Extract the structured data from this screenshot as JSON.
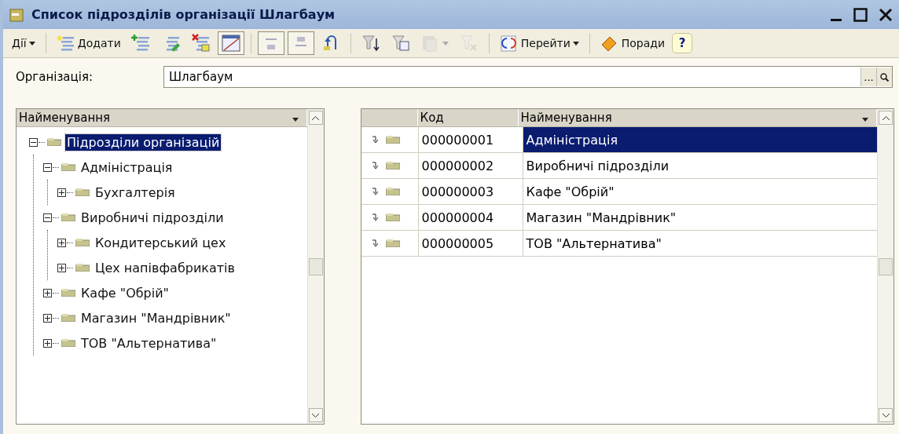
{
  "window": {
    "title": "Список підрозділів організації Шлагбаум"
  },
  "toolbar": [
    {
      "kind": "menu",
      "label": "Дії"
    },
    {
      "kind": "separator"
    },
    {
      "kind": "button",
      "label": "Додати"
    },
    {
      "kind": "button"
    },
    {
      "kind": "button"
    },
    {
      "kind": "button"
    },
    {
      "kind": "button",
      "pressed": true
    },
    {
      "kind": "separator"
    },
    {
      "kind": "button",
      "pressed": true
    },
    {
      "kind": "button",
      "pressed": true
    },
    {
      "kind": "button"
    },
    {
      "kind": "separator"
    },
    {
      "kind": "button"
    },
    {
      "kind": "button"
    },
    {
      "kind": "dropdown",
      "disabled": true
    },
    {
      "kind": "button",
      "disabled": true
    },
    {
      "kind": "separator"
    },
    {
      "kind": "menu",
      "label": "Перейти"
    },
    {
      "kind": "separator"
    },
    {
      "kind": "button",
      "label": "Поради"
    },
    {
      "kind": "help",
      "label": "?"
    }
  ],
  "organization": {
    "label": "Організація:",
    "value": "Шлагбаум",
    "select_button": "..."
  },
  "tree": {
    "column": "Найменування",
    "nodes": [
      {
        "label": "Підрозділи організацій",
        "expanded": true,
        "selected": true,
        "children": [
          {
            "label": "Адміністрація",
            "expanded": true,
            "selected": false,
            "children": [
              {
                "label": "Бухгалтерія",
                "expanded": false,
                "selected": false
              }
            ]
          },
          {
            "label": "Виробничі підрозділи",
            "expanded": true,
            "selected": false,
            "children": [
              {
                "label": "Кондитерський цех",
                "expanded": false,
                "selected": false
              },
              {
                "label": "Цех напівфабрикатів",
                "expanded": false,
                "selected": false
              }
            ]
          },
          {
            "label": "Кафе \"Обрій\"",
            "expanded": false,
            "selected": false
          },
          {
            "label": "Магазин \"Мандрівник\"",
            "expanded": false,
            "selected": false
          },
          {
            "label": "ТОВ \"Альтернатива\"",
            "expanded": false,
            "selected": false
          }
        ]
      }
    ]
  },
  "table": {
    "columns": [
      "Код",
      "Найменування"
    ],
    "rows": [
      {
        "code": "000000001",
        "name": "Адміністрація",
        "selected": true
      },
      {
        "code": "000000002",
        "name": "Виробничі підрозділи",
        "selected": false
      },
      {
        "code": "000000003",
        "name": "Кафе \"Обрій\"",
        "selected": false
      },
      {
        "code": "000000004",
        "name": "Магазин \"Мандрівник\"",
        "selected": false
      },
      {
        "code": "000000005",
        "name": "ТОВ \"Альтернатива\"",
        "selected": false
      }
    ]
  }
}
